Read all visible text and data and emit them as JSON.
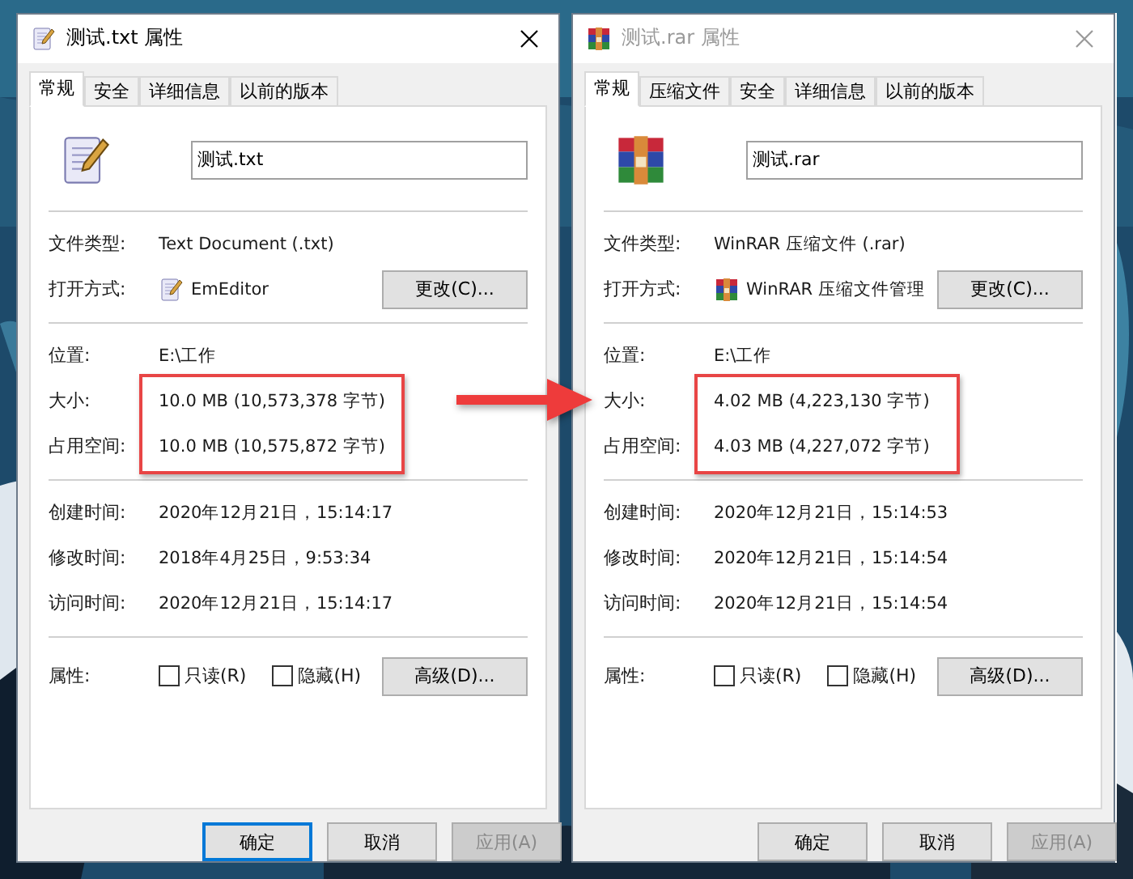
{
  "dialogs": [
    {
      "title": "测试.txt 属性",
      "active": true,
      "kind": "text",
      "tabs": [
        {
          "label": "常规",
          "selected": true
        },
        {
          "label": "安全",
          "selected": false
        },
        {
          "label": "详细信息",
          "selected": false
        },
        {
          "label": "以前的版本",
          "selected": false
        }
      ],
      "file_name": "测试.txt",
      "sections": [
        {
          "rows": [
            {
              "label": "文件类型:",
              "value": "Text Document (.txt)",
              "highlighted": false
            },
            {
              "label": "打开方式:",
              "value": "EmEditor",
              "button": "更改(C)...",
              "highlighted": false
            }
          ]
        },
        {
          "rows": [
            {
              "label": "位置:",
              "value": "E:\\工作",
              "highlighted": false
            },
            {
              "label": "大小:",
              "value": "10.0 MB (10,573,378 字节)",
              "highlighted": true
            },
            {
              "label": "占用空间:",
              "value": "10.0 MB (10,575,872 字节)",
              "highlighted": true
            }
          ]
        },
        {
          "rows": [
            {
              "label": "创建时间:",
              "value": "2020年12月21日，15:14:17",
              "highlighted": false
            },
            {
              "label": "修改时间:",
              "value": "2018年4月25日，9:53:34",
              "highlighted": false
            },
            {
              "label": "访问时间:",
              "value": "2020年12月21日，15:14:17",
              "highlighted": false
            }
          ]
        }
      ],
      "attributes": {
        "label": "属性:",
        "checkboxes": [
          {
            "label": "只读(R)",
            "checked": false
          },
          {
            "label": "隐藏(H)",
            "checked": false
          }
        ],
        "button": "高级(D)..."
      },
      "buttons": [
        {
          "label": "确定",
          "default": true,
          "disabled": false
        },
        {
          "label": "取消",
          "default": false,
          "disabled": false
        },
        {
          "label": "应用(A)",
          "default": false,
          "disabled": true
        }
      ]
    },
    {
      "title": "测试.rar 属性",
      "active": false,
      "kind": "archive",
      "tabs": [
        {
          "label": "常规",
          "selected": true
        },
        {
          "label": "压缩文件",
          "selected": false
        },
        {
          "label": "安全",
          "selected": false
        },
        {
          "label": "详细信息",
          "selected": false
        },
        {
          "label": "以前的版本",
          "selected": false
        }
      ],
      "file_name": "测试.rar",
      "sections": [
        {
          "rows": [
            {
              "label": "文件类型:",
              "value": "WinRAR 压缩文件 (.rar)",
              "highlighted": false
            },
            {
              "label": "打开方式:",
              "value": "WinRAR 压缩文件管理",
              "button": "更改(C)...",
              "highlighted": false
            }
          ]
        },
        {
          "rows": [
            {
              "label": "位置:",
              "value": "E:\\工作",
              "highlighted": false
            },
            {
              "label": "大小:",
              "value": "4.02 MB (4,223,130 字节)",
              "highlighted": true
            },
            {
              "label": "占用空间:",
              "value": "4.03 MB (4,227,072 字节)",
              "highlighted": true
            }
          ]
        },
        {
          "rows": [
            {
              "label": "创建时间:",
              "value": "2020年12月21日，15:14:53",
              "highlighted": false
            },
            {
              "label": "修改时间:",
              "value": "2020年12月21日，15:14:54",
              "highlighted": false
            },
            {
              "label": "访问时间:",
              "value": "2020年12月21日，15:14:54",
              "highlighted": false
            }
          ]
        }
      ],
      "attributes": {
        "label": "属性:",
        "checkboxes": [
          {
            "label": "只读(R)",
            "checked": false
          },
          {
            "label": "隐藏(H)",
            "checked": false
          }
        ],
        "button": "高级(D)..."
      },
      "buttons": [
        {
          "label": "确定",
          "default": false,
          "disabled": false
        },
        {
          "label": "取消",
          "default": false,
          "disabled": false
        },
        {
          "label": "应用(A)",
          "default": false,
          "disabled": true
        }
      ]
    }
  ]
}
